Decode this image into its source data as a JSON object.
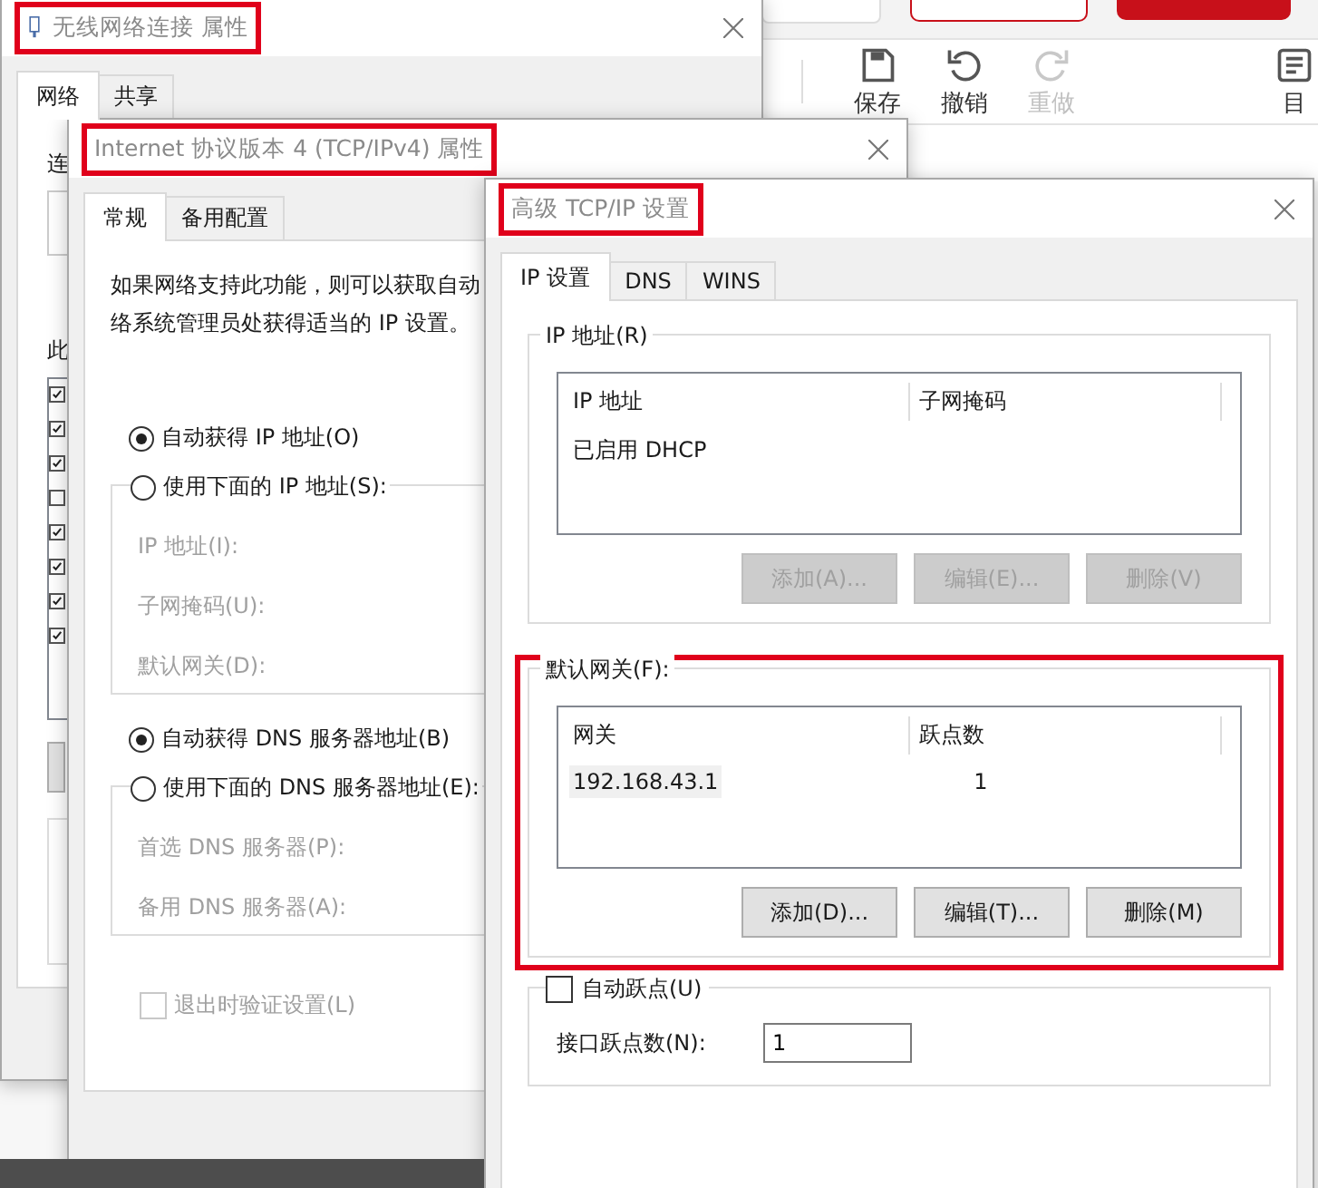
{
  "editor": {
    "toolbar": [
      {
        "kind": "save",
        "label": "保存",
        "disabled": false
      },
      {
        "kind": "undo",
        "label": "撤销",
        "disabled": false
      },
      {
        "kind": "redo",
        "label": "重做",
        "disabled": true
      },
      {
        "kind": "toc",
        "label": "目",
        "disabled": false
      }
    ]
  },
  "wireless_window": {
    "title": "无线网络连接 属性",
    "highlighted": true,
    "tabs": [
      {
        "label": "网络",
        "selected": true
      },
      {
        "label": "共享",
        "selected": false
      }
    ],
    "label_1": "连",
    "label_2": "此",
    "items": [
      {
        "checked": true
      },
      {
        "checked": true
      },
      {
        "checked": true
      },
      {
        "checked": false
      },
      {
        "checked": true
      },
      {
        "checked": true
      },
      {
        "checked": true
      },
      {
        "checked": true
      }
    ]
  },
  "ipv4_window": {
    "title": "Internet 协议版本 4 (TCP/IPv4) 属性",
    "highlighted": true,
    "tabs": [
      {
        "label": "常规",
        "selected": true
      },
      {
        "label": "备用配置",
        "selected": false
      }
    ],
    "intro": [
      "如果网络支持此功能，则可以获取自动",
      "络系统管理员处获得适当的 IP 设置。"
    ],
    "ip_options": [
      {
        "label": "自动获得 IP 地址(O)",
        "selected": true
      },
      {
        "label": "使用下面的 IP 地址(S):",
        "selected": false
      }
    ],
    "ip_fields": [
      "IP 地址(I):",
      "子网掩码(U):",
      "默认网关(D):"
    ],
    "dns_options": [
      {
        "label": "自动获得 DNS 服务器地址(B)",
        "selected": true
      },
      {
        "label": "使用下面的 DNS 服务器地址(E):",
        "selected": false
      }
    ],
    "dns_fields": [
      "首选 DNS 服务器(P):",
      "备用 DNS 服务器(A):"
    ],
    "validate": {
      "label": "退出时验证设置(L)",
      "checked": false,
      "disabled": true
    }
  },
  "advanced_window": {
    "title": "高级 TCP/IP 设置",
    "highlighted": true,
    "tabs": [
      {
        "label": "IP 设置",
        "selected": true
      },
      {
        "label": "DNS",
        "selected": false
      },
      {
        "label": "WINS",
        "selected": false
      }
    ],
    "groups": [
      {
        "label": "IP 地址(R)",
        "highlighted": false,
        "columns": [
          "IP 地址",
          "子网掩码"
        ],
        "rows": [
          {
            "cells": [
              "已启用 DHCP"
            ],
            "selected": false
          }
        ],
        "buttons": [
          {
            "label": "添加(A)...",
            "disabled": true
          },
          {
            "label": "编辑(E)...",
            "disabled": true
          },
          {
            "label": "删除(V)",
            "disabled": true
          }
        ]
      },
      {
        "label": "默认网关(F):",
        "highlighted": true,
        "columns": [
          "网关",
          "跃点数"
        ],
        "rows": [
          {
            "cells": [
              "192.168.43.1",
              "1"
            ],
            "selected": true
          }
        ],
        "buttons": [
          {
            "label": "添加(D)...",
            "disabled": false
          },
          {
            "label": "编辑(T)...",
            "disabled": false
          },
          {
            "label": "删除(M)",
            "disabled": false
          }
        ]
      }
    ],
    "auto_metric": {
      "label": "自动跃点(U)",
      "checked": false
    },
    "metric": {
      "label": "接口跃点数(N):",
      "value": "1"
    }
  }
}
